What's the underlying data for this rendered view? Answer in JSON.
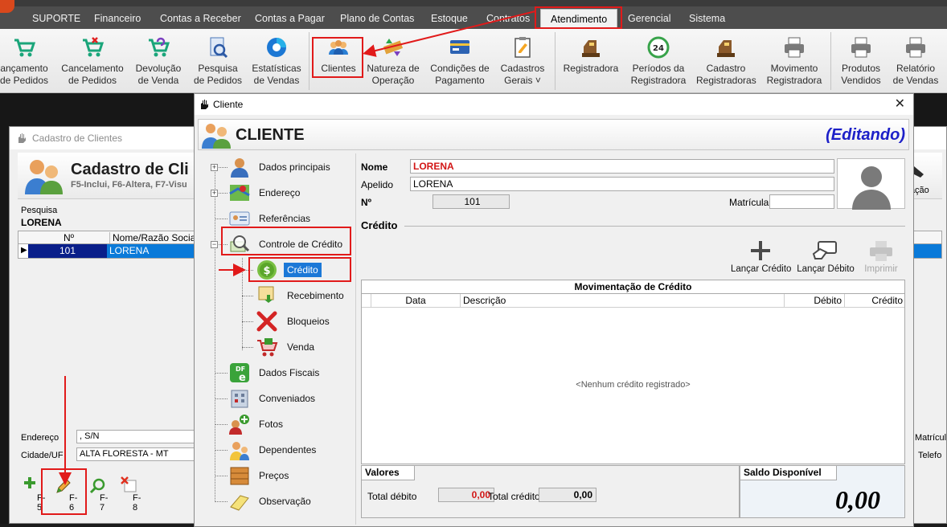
{
  "menubar": {
    "items": [
      "SUPORTE",
      "Financeiro",
      "Contas a Receber",
      "Contas a Pagar",
      "Plano de Contas",
      "Estoque",
      "Contratos",
      "Atendimento",
      "Gerencial",
      "Sistema"
    ],
    "active": "Atendimento"
  },
  "ribbon": {
    "buttons": [
      {
        "line1": "ançamento",
        "line2": "de Pedidos",
        "icon": "cart-icon"
      },
      {
        "line1": "Cancelamento",
        "line2": "de Pedidos",
        "icon": "cart-cancel-icon"
      },
      {
        "line1": "Devolução",
        "line2": "de Venda",
        "icon": "cart-return-icon"
      },
      {
        "line1": "Pesquisa",
        "line2": "de Pedidos",
        "icon": "document-search-icon"
      },
      {
        "line1": "Estatísticas",
        "line2": "de Vendas",
        "icon": "pie-chart-icon"
      },
      {
        "line1": "Clientes",
        "line2": "",
        "icon": "users-icon"
      },
      {
        "line1": "Natureza de",
        "line2": "Operação",
        "icon": "operation-icon"
      },
      {
        "line1": "Condições de",
        "line2": "Pagamento",
        "icon": "credit-card-icon"
      },
      {
        "line1": "Cadastros",
        "line2": "Gerais ˅",
        "icon": "clipboard-icon"
      },
      {
        "line1": "Registradora",
        "line2": "",
        "icon": "cash-register-icon"
      },
      {
        "line1": "Períodos da",
        "line2": "Registradora",
        "icon": "24h-icon"
      },
      {
        "line1": "Cadastro",
        "line2": "Registradoras",
        "icon": "cash-register-icon"
      },
      {
        "line1": "Movimento",
        "line2": "Registradora",
        "icon": "printer-icon"
      },
      {
        "line1": "Produtos",
        "line2": "Vendidos",
        "icon": "printer-icon"
      },
      {
        "line1": "Relatório",
        "line2": "de Vendas",
        "icon": "printer-icon"
      }
    ]
  },
  "bgwin": {
    "title": "Cadastro de Clientes",
    "header_title": "Cadastro de Cli",
    "header_sub": "F5-Inclui, F6-Altera, F7-Visu",
    "pesquisa_label": "Pesquisa",
    "pesquisa_value": "LORENA",
    "col_num": "Nº",
    "col_nome": "Nome/Razão Social",
    "row_num": "101",
    "row_nome": "LORENA",
    "endereco_label": "Endereço",
    "endereco_value": ", S/N",
    "cidade_label": "Cidade/UF",
    "cidade_value": "ALTA FLORESTA - MT",
    "right_text_1": "ciação",
    "right_text_2": "Matrícul",
    "right_text_3": "Telefo",
    "footer": [
      "F-5",
      "F-6",
      "F-7",
      "F-8"
    ]
  },
  "dialog": {
    "window_title": "Cliente",
    "header_title": "CLIENTE",
    "mode": "(Editando)",
    "tree": [
      {
        "label": "Dados principais",
        "icon": "user-icon"
      },
      {
        "label": "Endereço",
        "icon": "map-icon"
      },
      {
        "label": "Referências",
        "icon": "id-card-icon"
      },
      {
        "label": "Controle de Crédito",
        "icon": "search-money-icon"
      },
      {
        "label": "Crédito",
        "icon": "dollar-coin-icon"
      },
      {
        "label": "Recebimento",
        "icon": "receipt-icon"
      },
      {
        "label": "Bloqueios",
        "icon": "red-x-icon"
      },
      {
        "label": "Venda",
        "icon": "cart-icon"
      },
      {
        "label": "Dados Fiscais",
        "icon": "dfe-icon"
      },
      {
        "label": "Conveniados",
        "icon": "building-icon"
      },
      {
        "label": "Fotos",
        "icon": "add-photo-icon"
      },
      {
        "label": "Dependentes",
        "icon": "family-icon"
      },
      {
        "label": "Preços",
        "icon": "box-icon"
      },
      {
        "label": "Observação",
        "icon": "note-icon"
      }
    ],
    "nome_label": "Nome",
    "nome_value": "LORENA",
    "apelido_label": "Apelido",
    "apelido_value": "LORENA",
    "num_label": "Nº",
    "num_value": "101",
    "matricula_label": "Matrícula",
    "matricula_value": "",
    "section_title": "Crédito",
    "toolbar": {
      "lancar_credito": "Lançar Crédito",
      "lancar_debito": "Lançar Débito",
      "imprimir": "Imprimir"
    },
    "mov": {
      "caption": "Movimentação de Crédito",
      "cols": [
        "Data",
        "Descrição",
        "Débito",
        "Crédito"
      ],
      "empty": "<Nenhum crédito registrado>"
    },
    "valores": {
      "tab": "Valores",
      "total_debito_label": "Total débito",
      "total_debito_value": "0,00",
      "total_credito_label": "Total crédito",
      "total_credito_value": "0,00"
    },
    "saldo": {
      "tab": "Saldo Disponível",
      "value": "0,00"
    }
  },
  "colors": {
    "menubar": "#4d4d4d",
    "annotation_red": "#e11a1a",
    "selection_blue": "#1b78d7",
    "mode_blue": "#1d20c8",
    "nome_red": "#d21515"
  }
}
